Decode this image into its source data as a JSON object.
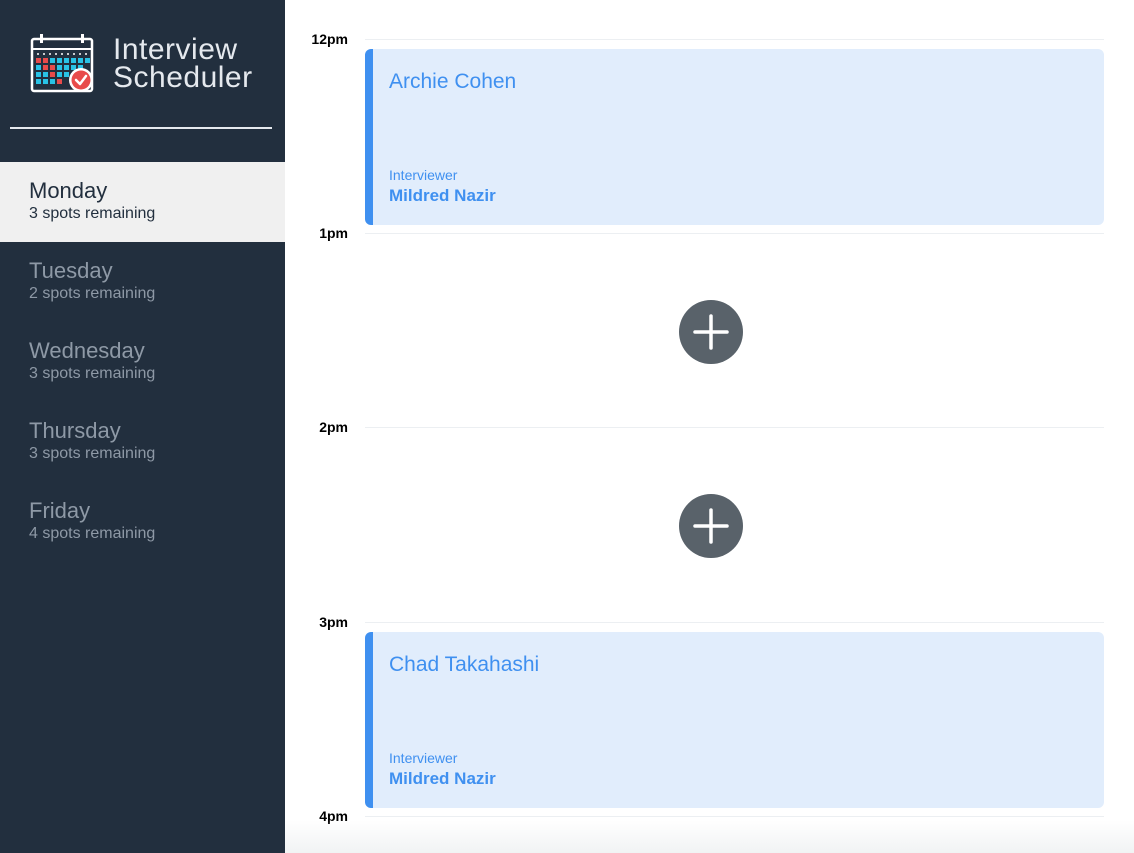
{
  "sidebar": {
    "title_line1": "Interview",
    "title_line2": "Scheduler",
    "days": [
      {
        "name": "Monday",
        "spots": "3 spots remaining",
        "selected": true
      },
      {
        "name": "Tuesday",
        "spots": "2 spots remaining",
        "selected": false
      },
      {
        "name": "Wednesday",
        "spots": "3 spots remaining",
        "selected": false
      },
      {
        "name": "Thursday",
        "spots": "3 spots remaining",
        "selected": false
      },
      {
        "name": "Friday",
        "spots": "4 spots remaining",
        "selected": false
      }
    ]
  },
  "schedule": {
    "slots": [
      {
        "time": "12pm",
        "student": "Archie Cohen",
        "interviewer_label": "Interviewer",
        "interviewer": "Mildred Nazir"
      },
      {
        "time": "1pm"
      },
      {
        "time": "2pm"
      },
      {
        "time": "3pm",
        "student": "Chad Takahashi",
        "interviewer_label": "Interviewer",
        "interviewer": "Mildred Nazir"
      },
      {
        "time": "4pm"
      }
    ]
  },
  "colors": {
    "sidebar_bg": "#222f3e",
    "selected_bg": "#f0f0f0",
    "accent": "#3f90f0",
    "appointment_bg": "#e1edfc",
    "add_button": "#59626a"
  }
}
